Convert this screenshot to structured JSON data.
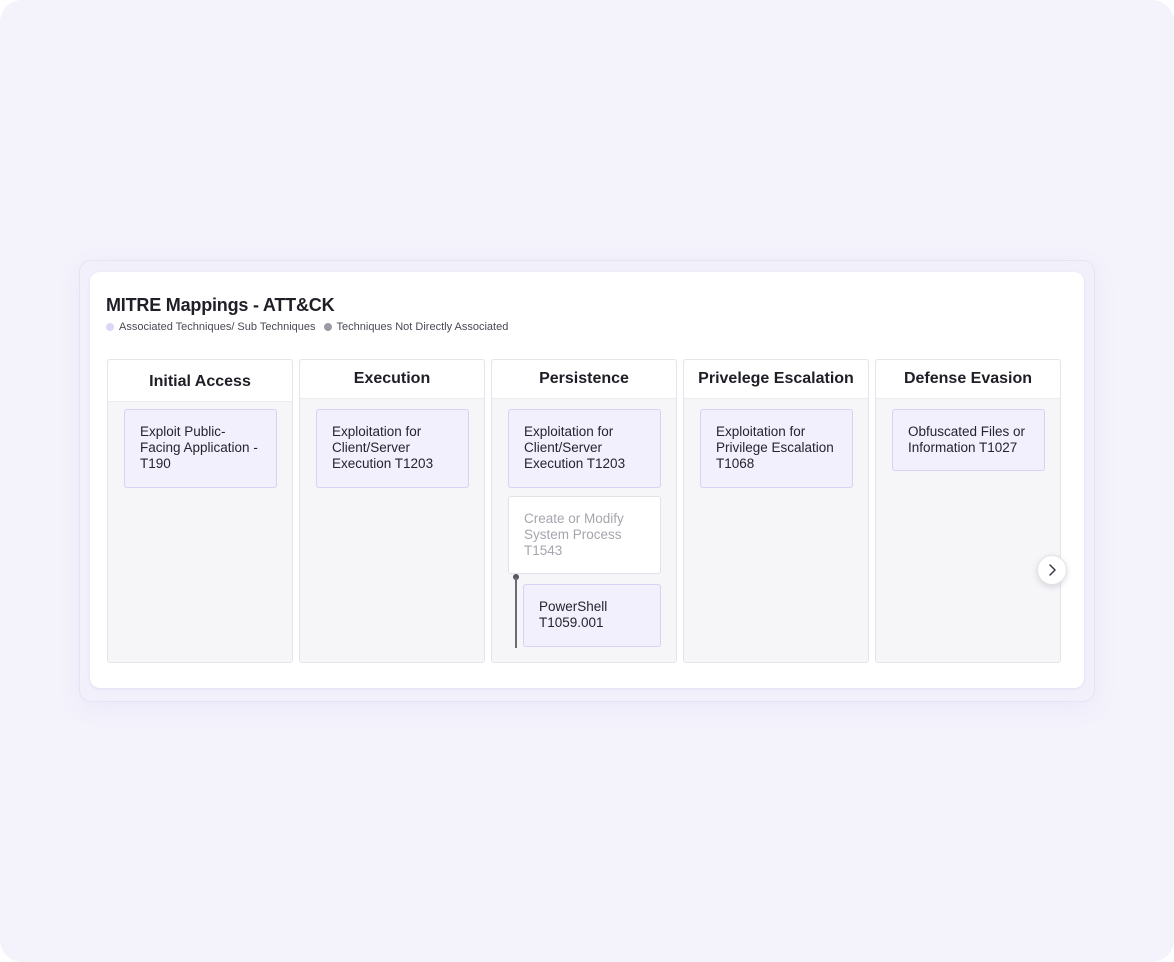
{
  "panel": {
    "title": "MITRE Mappings - ATT&CK",
    "legend": [
      {
        "label": "Associated Techniques/ Sub Techniques",
        "color": "#dcd6f7"
      },
      {
        "label": "Techniques Not Directly Associated",
        "color": "#9b9ba3"
      }
    ]
  },
  "columns": [
    {
      "name": "Initial Access",
      "techniques": [
        {
          "label": "Exploit Public-Facing Application - T190",
          "associated": true
        }
      ]
    },
    {
      "name": "Execution",
      "techniques": [
        {
          "label": "Exploitation for Client/Server Execution T1203",
          "associated": true
        }
      ]
    },
    {
      "name": "Persistence",
      "techniques": [
        {
          "label": "Exploitation for Client/Server Execution T1203",
          "associated": true
        },
        {
          "label": "Create or Modify System Process T1543",
          "associated": false
        },
        {
          "label": "PowerShell T1059.001",
          "associated": true,
          "sub_technique": true
        }
      ]
    },
    {
      "name": "Privelege Escalation",
      "techniques": [
        {
          "label": "Exploitation for Privilege Escalation T1068",
          "associated": true
        }
      ]
    },
    {
      "name": "Defense Evasion",
      "techniques": [
        {
          "label": "Obfuscated Files or Information T1027",
          "associated": true
        }
      ]
    }
  ],
  "controls": {
    "next_icon": "chevron-right-icon"
  },
  "colors": {
    "associated_bg": "#f3f0fd",
    "associated_border": "#d8d1f3",
    "not_associated_text": "#a5a5ad",
    "background": "#f4f3fc"
  }
}
